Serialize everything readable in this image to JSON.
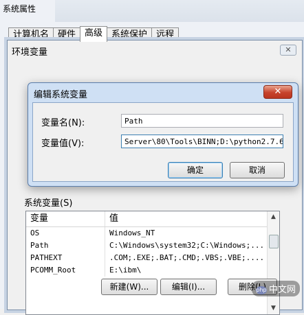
{
  "system_properties": {
    "title": "系统属性",
    "tabs": [
      {
        "label": "计算机名"
      },
      {
        "label": "硬件"
      },
      {
        "label": "高级",
        "active": true
      },
      {
        "label": "系统保护"
      },
      {
        "label": "远程"
      }
    ]
  },
  "env_window": {
    "title": "环境变量",
    "close": "✕",
    "system_vars_label": "系统变量(S)",
    "columns": [
      "变量",
      "值"
    ],
    "rows": [
      {
        "name": "OS",
        "value": "Windows_NT"
      },
      {
        "name": "Path",
        "value": "C:\\Windows\\system32;C:\\Windows;..."
      },
      {
        "name": "PATHEXT",
        "value": ".COM;.EXE;.BAT;.CMD;.VBS;.VBE;...."
      },
      {
        "name": "PCOMM_Root",
        "value": "E:\\ibm\\"
      }
    ],
    "buttons": {
      "new": "新建(W)...",
      "edit": "编辑(I)...",
      "delete": "删除(L)"
    }
  },
  "edit_dialog": {
    "title": "编辑系统变量",
    "close": "✕",
    "name_label": "变量名(N):",
    "name_value": "Path",
    "value_label": "变量值(V):",
    "value_value": "Server\\80\\Tools\\BINN;D:\\python2.7.6",
    "ok": "确定",
    "cancel": "取消"
  },
  "watermark": {
    "logo": "php",
    "text": "中文网"
  },
  "colors": {
    "dialog_frame": "#cfe0f4",
    "close_red": "#c7432c",
    "window_bg": "#f0f0f0"
  }
}
